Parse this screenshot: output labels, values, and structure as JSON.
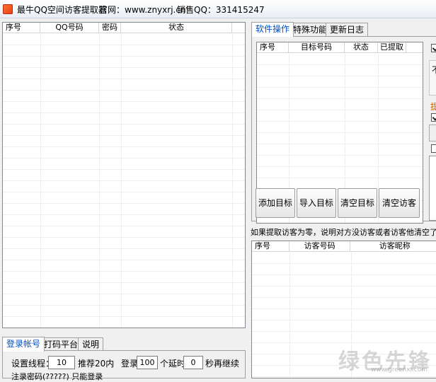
{
  "window": {
    "title": "最牛QQ空间访客提取器",
    "site": "官网：www.znyxrj.cn",
    "sales_qq": "销售QQ：331415247"
  },
  "accounts_list": {
    "columns": [
      "序号",
      "QQ号码",
      "密码",
      "状态"
    ]
  },
  "bottom_tabs": {
    "tabs": [
      "登录帐号",
      "打码平台",
      "说明"
    ],
    "thread_label": "设置线程：",
    "thread_value": "10",
    "thread_hint": "推荐20内",
    "login_label": "登录",
    "login_count": "100",
    "delay_label": "个延时",
    "delay_value": "0",
    "continue_label": "秒再继续",
    "partial_line": "注录密码(?????) 只能登录"
  },
  "right_tabs": {
    "tabs": [
      "软件操作",
      "特殊功能",
      "更新日志"
    ]
  },
  "target_list": {
    "columns": [
      "序号",
      "目标号码",
      "状态",
      "已提取"
    ]
  },
  "target_buttons": {
    "add": "添加目标",
    "import": "导入目标",
    "clear_targets": "清空目标",
    "clear_visitors": "清空访客"
  },
  "right_panel_partial": {
    "text1": "不",
    "text2": "提"
  },
  "notice": "如果提取访客为零，说明对方没访客或者访客他清空了，",
  "visitor_list": {
    "columns": [
      "序号",
      "访客号码",
      "访客昵称"
    ]
  },
  "watermark": {
    "text": "绿色先锋",
    "sub": "www.greenxf.com"
  }
}
